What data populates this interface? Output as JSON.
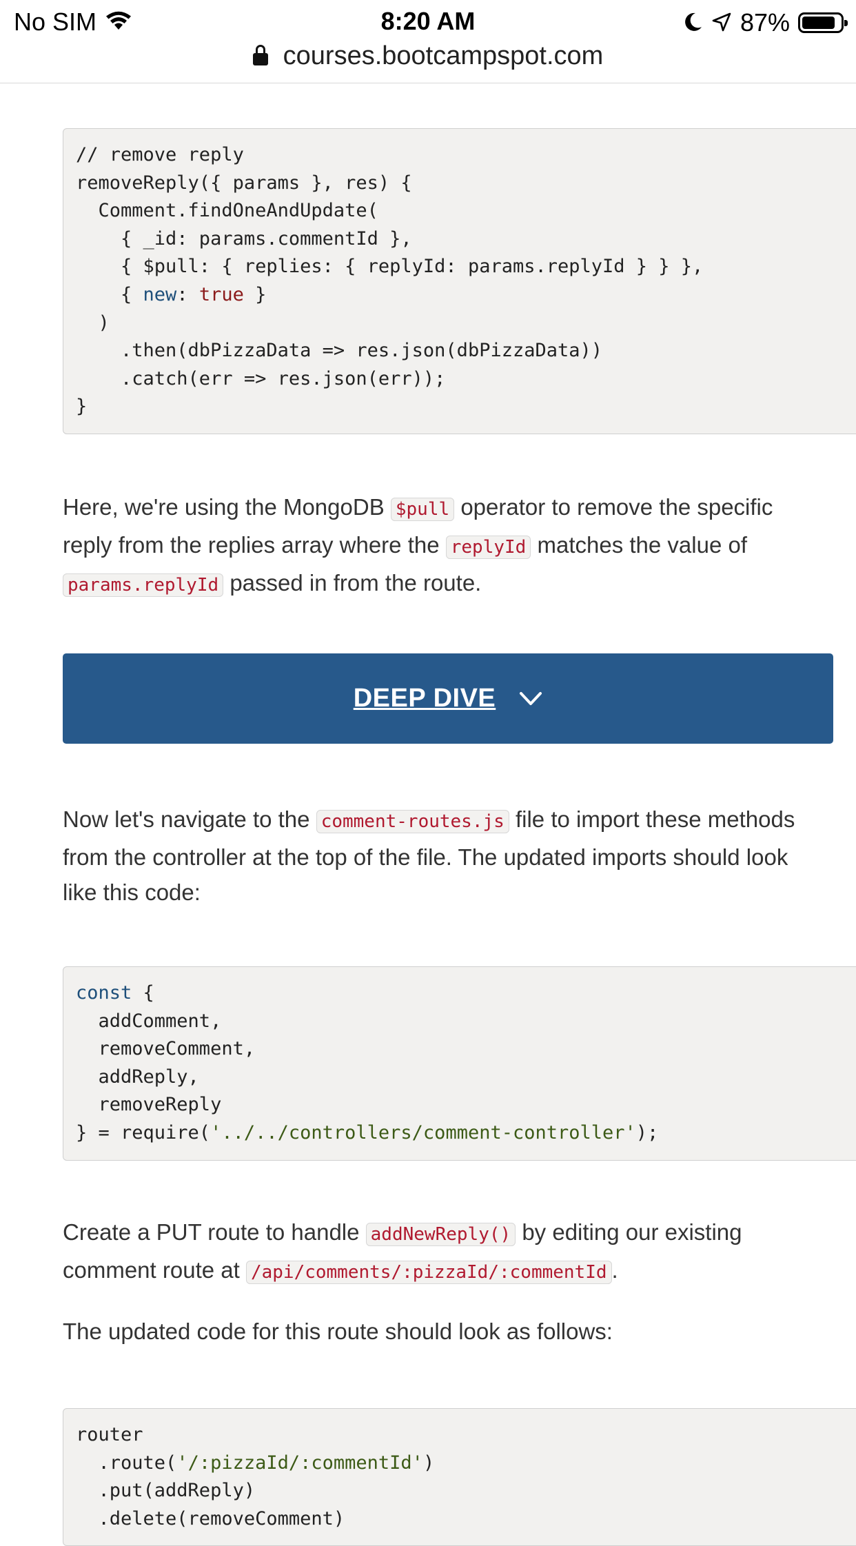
{
  "status_bar": {
    "carrier": "No SIM",
    "time": "8:20 AM",
    "battery_percent": "87%",
    "battery_level": 0.87,
    "icons": [
      "wifi-icon",
      "moon-icon",
      "location-arrow-icon",
      "battery-icon"
    ]
  },
  "browser": {
    "url": "courses.bootcampspot.com",
    "icons": [
      "lock-icon"
    ]
  },
  "code_block_1": {
    "lines": [
      "// remove reply",
      "removeReply({ params }, res) {",
      "  Comment.findOneAndUpdate(",
      "    { _id: params.commentId },",
      "    { $pull: { replies: { replyId: params.replyId } } },",
      "    { ",
      "new",
      ": ",
      "true",
      " }",
      "  )",
      "    .then(dbPizzaData => res.json(dbPizzaData))",
      "    .catch(err => res.json(err));",
      "}"
    ]
  },
  "para_pull": {
    "t1": "Here, we're using the MongoDB ",
    "c1": "$pull",
    "t2": " operator to remove the specific reply from the replies array where the ",
    "c2": "replyId",
    "t3": " matches the value of ",
    "c3": "params.replyId",
    "t4": " passed in from the route."
  },
  "deep_dive": {
    "label": "DEEP DIVE",
    "icon": "chevron-down-icon",
    "accent_color": "#27598b"
  },
  "para_nav": {
    "t1": "Now let's navigate to the ",
    "c1": "comment-routes.js",
    "t2": " file to import these methods from the controller at the top of the file. The updated imports should look like this code:"
  },
  "code_block_2": {
    "const_kw": "const",
    "l1_rest": " {",
    "l2": "  addComment,",
    "l3": "  removeComment,",
    "l4": "  addReply,",
    "l5": "  removeReply",
    "l6_start": "} = require(",
    "l6_str": "'../../controllers/comment-controller'",
    "l6_end": ");"
  },
  "para_put": {
    "t1": "Create a PUT route to handle ",
    "c1": "addNewReply()",
    "t2": " by editing our existing comment route at ",
    "c2": "/api/comments/:pizzaId/:commentId",
    "t3": "."
  },
  "para_updated": {
    "text": "The updated code for this route should look as follows:"
  },
  "code_block_3": {
    "l1": "router",
    "l2_start": "  .route(",
    "l2_str": "'/:pizzaId/:commentId'",
    "l2_end": ")",
    "l3": "  .put(addReply)",
    "l4": "  .delete(removeComment)"
  }
}
